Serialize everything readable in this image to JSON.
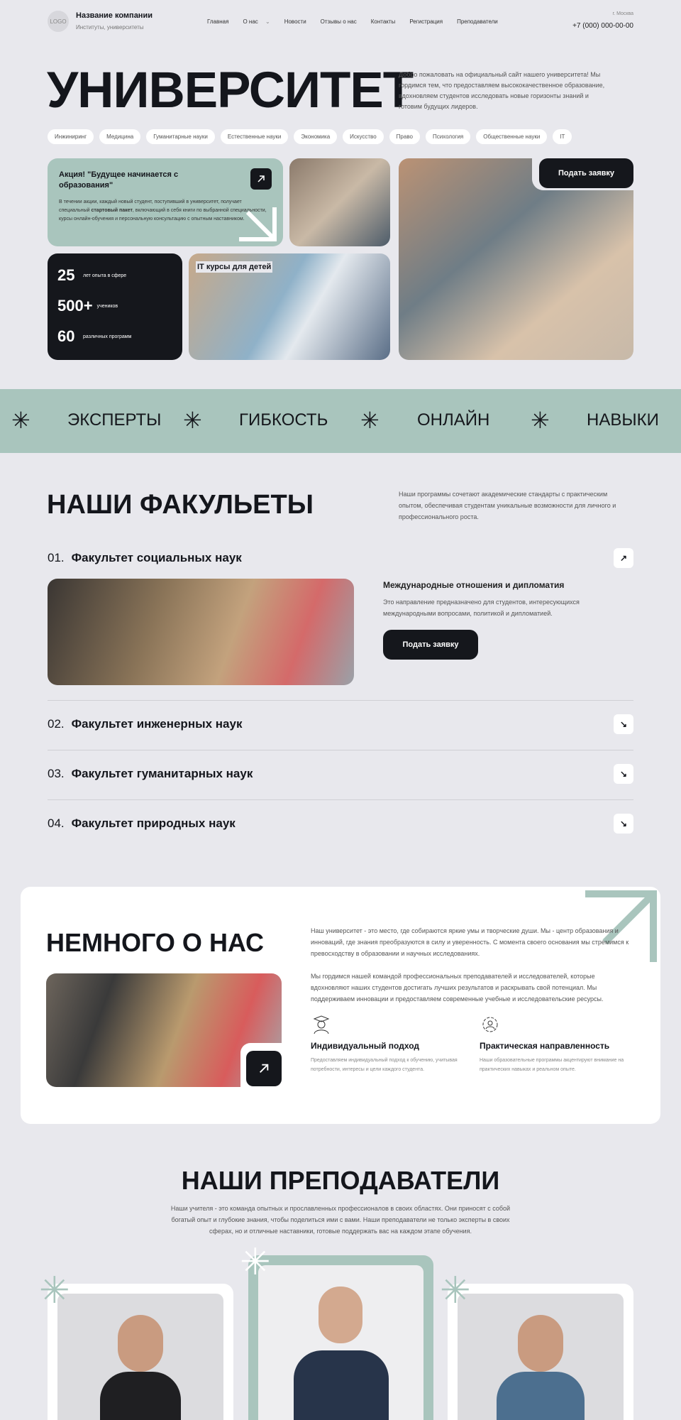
{
  "header": {
    "logo": "LOGO",
    "company": "Название компании",
    "company_sub": "Институты, университеты",
    "nav": [
      "Главная",
      "О нас",
      "Новости",
      "Отзывы о нас",
      "Контакты",
      "Регистрация",
      "Преподаватели"
    ],
    "city": "г. Москва",
    "phone": "+7 (000) 000-00-00"
  },
  "hero": {
    "title": "УНИВЕРСИТЕТ",
    "description": "Добро пожаловать на официальный сайт нашего университета! Мы гордимся тем, что предоставляем высококачественное образование, вдохновляем студентов исследовать новые горизонты знаний и готовим будущих лидеров.",
    "tags": [
      "Инжиниринг",
      "Медицина",
      "Гуманитарные науки",
      "Естественные науки",
      "Экономика",
      "Искусство",
      "Право",
      "Психология",
      "Общественные науки",
      "IT"
    ],
    "promo_title": "Акция! \"Будущее начинается с образования\"",
    "promo_text_1": "В течении акции, каждый новый студент, поступивший в университет, получает специальный ",
    "promo_text_bold": "стартовый пакет",
    "promo_text_2": ", включающий в себя книги по выбранной специальности, курсы онлайн-обучения и персональную консультацию с опытным наставником.",
    "stats": [
      {
        "number": "25",
        "label": "лет опыта в сфере"
      },
      {
        "number": "500+",
        "label": "учеников"
      },
      {
        "number": "60",
        "label": "различных программ"
      }
    ],
    "it_label": "IT курсы для детей",
    "apply": "Подать заявку"
  },
  "band": [
    "ЭКСПЕРТЫ",
    "ГИБКОСТЬ",
    "ОНЛАЙН",
    "НАВЫКИ"
  ],
  "faculties": {
    "title": "НАШИ ФАКУЛЬЕТЫ",
    "description": "Наши программы сочетают академические стандарты с практическим опытом, обеспечивая студентам уникальные возможности для личного и профессионального роста.",
    "items": [
      {
        "num": "01.",
        "name": "Факультет социальных наук"
      },
      {
        "num": "02.",
        "name": "Факультет инженерных наук"
      },
      {
        "num": "03.",
        "name": "Факультет гуманитарных наук"
      },
      {
        "num": "04.",
        "name": "Факультет природных наук"
      }
    ],
    "detail_title": "Международные отношения и дипломатия",
    "detail_text": "Это направление предназначено для студентов, интересующихся международными вопросами, политикой и дипломатией.",
    "apply": "Подать заявку"
  },
  "about": {
    "title": "НЕМНОГО О НАС",
    "p1": "Наш университет - это место, где собираются яркие умы и творческие души. Мы - центр образования и инноваций, где знания преобразуются в силу и уверенность. С момента своего основания мы стремимся к превосходству в образовании и научных исследованиях.",
    "p2": "Мы гордимся нашей командой профессиональных преподавателей и исследователей, которые вдохновляют наших студентов достигать лучших результатов и раскрывать свой потенциал. Мы поддерживаем инновации и предоставляем современные учебные и исследовательские ресурсы.",
    "features": [
      {
        "title": "Индивидуальный подход",
        "text": "Предоставляем индивидуальный подход к обучению, учитывая потребности, интересы и цели каждого студента."
      },
      {
        "title": "Практическая направленность",
        "text": "Наши образовательные программы акцентируют внимание на практических навыках и реальном опыте."
      }
    ]
  },
  "teachers": {
    "title": "НАШИ ПРЕПОДАВАТЕЛИ",
    "description": "Наши учителя - это команда опытных и прославленных профессионалов в своих областях. Они приносят с собой богатый опыт и глубокие знания, чтобы поделиться ими с вами. Наши преподаватели не только эксперты в своих сферах, но и отличные наставники, готовые поддержать вас на каждом этапе обучения."
  },
  "colors": {
    "accent": "#a9c5bd",
    "dark": "#15171c",
    "background": "#e8e8ed"
  }
}
